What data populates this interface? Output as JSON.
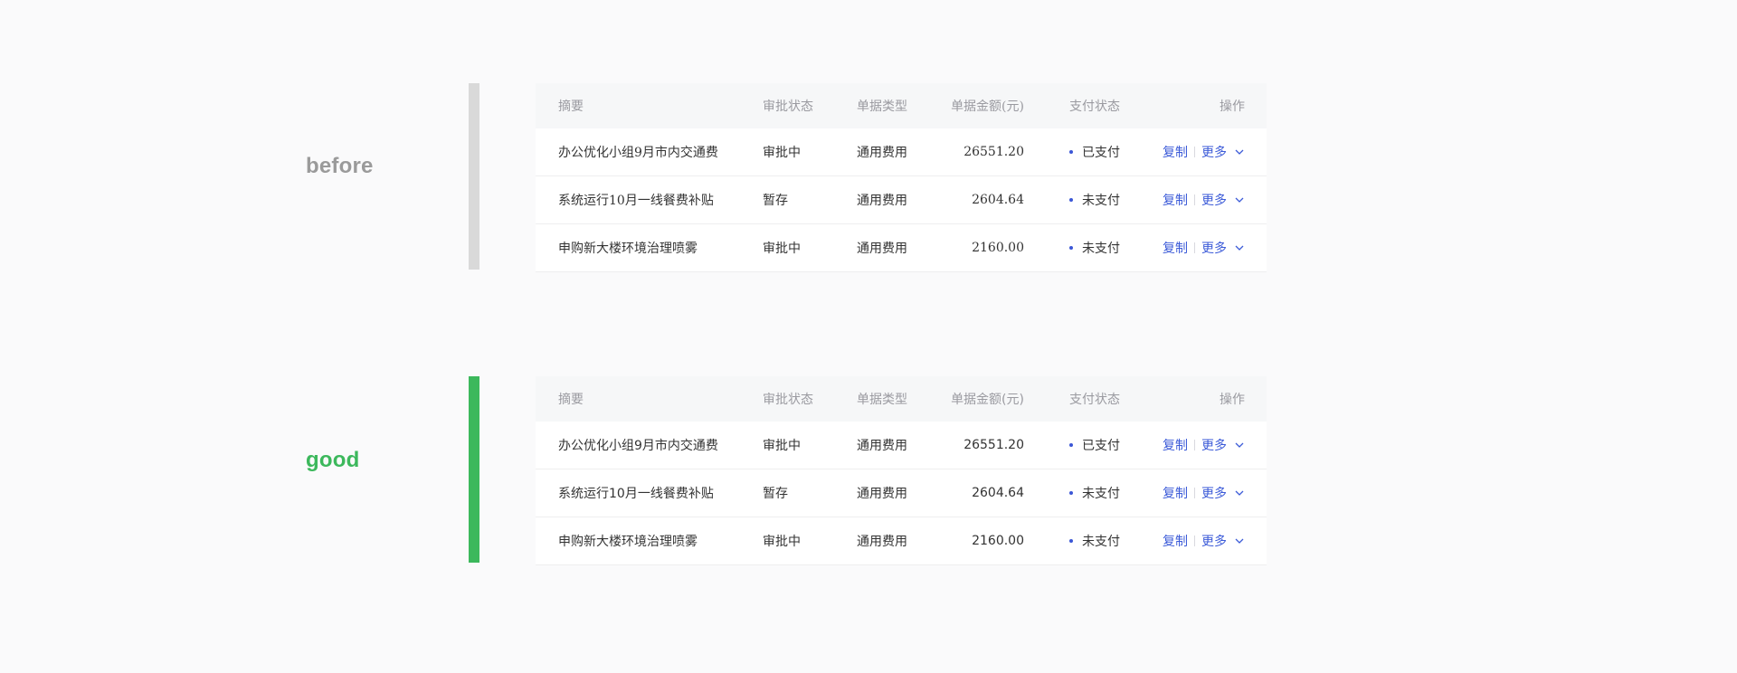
{
  "colors": {
    "before_accent": "#d9d9d9",
    "before_label": "#9a9a9a",
    "good_accent": "#3cb85c",
    "good_label": "#3cb85c",
    "link": "#3c5bd8",
    "status_dot": "#3b57d6"
  },
  "columns": {
    "summary": "摘要",
    "approval": "审批状态",
    "type": "单据类型",
    "amount": "单据金额(元)",
    "payment": "支付状态",
    "ops": "操作"
  },
  "actions": {
    "copy": "复制",
    "more": "更多"
  },
  "icons": {
    "more_dropdown": "chevron-down-icon",
    "status": "status-dot-icon"
  },
  "sections": [
    {
      "label": "before",
      "rows": [
        {
          "summary": "办公优化小组9月市内交通费",
          "approval": "审批中",
          "type": "通用费用",
          "amount": "26551.20",
          "payment": "已支付"
        },
        {
          "summary": "系统运行10月一线餐费补贴",
          "approval": "暂存",
          "type": "通用费用",
          "amount": "2604.64",
          "payment": "未支付"
        },
        {
          "summary": "申购新大楼环境治理喷雾",
          "approval": "审批中",
          "type": "通用费用",
          "amount": "2160.00",
          "payment": "未支付"
        }
      ]
    },
    {
      "label": "good",
      "rows": [
        {
          "summary": "办公优化小组9月市内交通费",
          "approval": "审批中",
          "type": "通用费用",
          "amount": "26551.20",
          "payment": "已支付"
        },
        {
          "summary": "系统运行10月一线餐费补贴",
          "approval": "暂存",
          "type": "通用费用",
          "amount": "2604.64",
          "payment": "未支付"
        },
        {
          "summary": "申购新大楼环境治理喷雾",
          "approval": "审批中",
          "type": "通用费用",
          "amount": "2160.00",
          "payment": "未支付"
        }
      ]
    }
  ]
}
